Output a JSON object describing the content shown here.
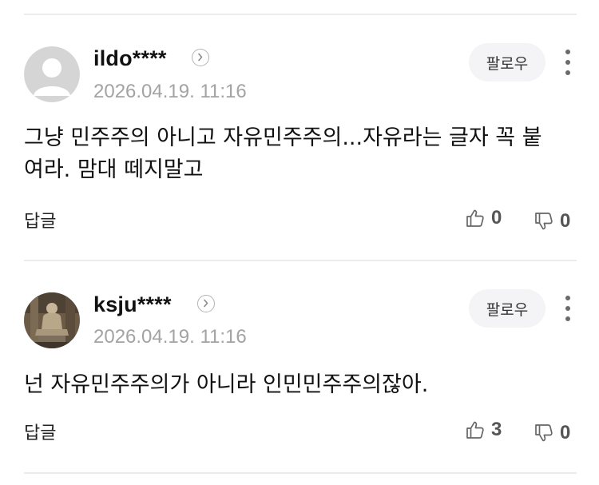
{
  "comments": [
    {
      "author": "ildo****",
      "timestamp": "2026.04.19. 11:16",
      "follow_label": "팔로우",
      "text": "그냥 민주주의 아니고 자유민주주의...자유라는 글자 꼭 붙여라. 맘대 떼지말고",
      "reply_label": "답글",
      "likes": "0",
      "dislikes": "0",
      "avatar": "default-profile-icon"
    },
    {
      "author": "ksju****",
      "timestamp": "2026.04.19. 11:16",
      "follow_label": "팔로우",
      "text": "넌 자유민주주의가 아니라 인민민주주의잖아.",
      "reply_label": "답글",
      "likes": "3",
      "dislikes": "0",
      "avatar": "statue-photo"
    }
  ],
  "colors": {
    "divider": "#ececec",
    "timestamp": "#a3a3a3",
    "follow_bg": "#f4f4f6"
  }
}
